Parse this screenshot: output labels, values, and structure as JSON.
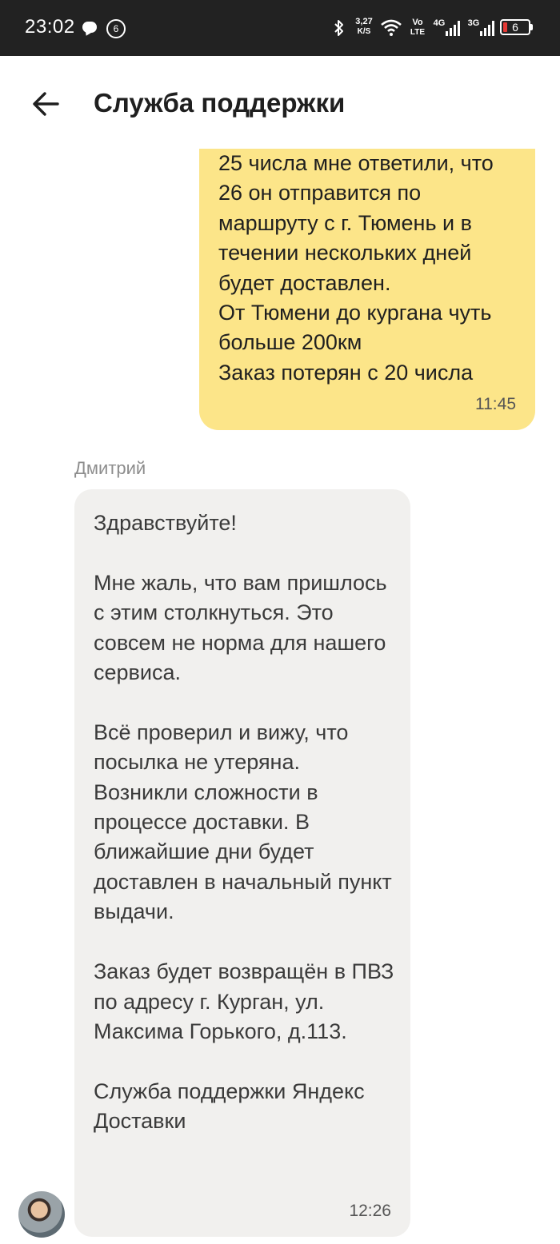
{
  "status_bar": {
    "time": "23:02",
    "notification_count": "6",
    "net_speed_value": "3,27",
    "net_speed_unit": "K/S",
    "volte_top": "Vo",
    "volte_bottom": "LTE",
    "sig1_label": "4G",
    "sig2_label": "3G",
    "battery_level": "6",
    "icons": [
      "chat-icon",
      "bluetooth-icon",
      "wifi-icon",
      "signal-icon",
      "battery-icon"
    ]
  },
  "header": {
    "title": "Служба поддержки"
  },
  "messages": {
    "outgoing": {
      "text": "25 числа мне ответили, что 26 он отправится по маршруту с г. Тюмень и в течении нескольких дней будет доставлен.\nОт Тюмени до кургана чуть больше 200км\nЗаказ потерян с 20 числа",
      "time": "11:45"
    },
    "incoming": {
      "sender": "Дмитрий",
      "text": "Здравствуйте!\n\nМне жаль, что вам пришлось с этим столкнуться. Это совсем не норма для нашего сервиса.\n\nВсё проверил и вижу, что посылка не утеряна. Возникли сложности в процессе доставки. В ближайшие дни будет доставлен в начальный пункт выдачи.\n\nЗаказ будет возвращён в ПВЗ по адресу г. Курган, ул. Максима Горького, д.113.\n\nСлужба поддержки Яндекс Доставки",
      "time": "12:26"
    }
  },
  "colors": {
    "outgoing_bubble": "#fce589",
    "incoming_bubble": "#f1f0ee",
    "status_bar": "#222222"
  }
}
